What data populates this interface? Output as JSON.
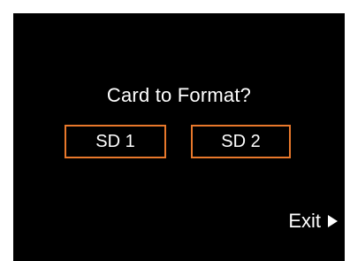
{
  "dialog": {
    "prompt": "Card to Format?",
    "options": [
      {
        "label": "SD 1"
      },
      {
        "label": "SD 2"
      }
    ],
    "exit_label": "Exit"
  },
  "colors": {
    "background": "#000000",
    "text": "#ffffff",
    "accent_border": "#e8782b"
  },
  "icons": {
    "exit": "play-arrow-right-icon"
  }
}
